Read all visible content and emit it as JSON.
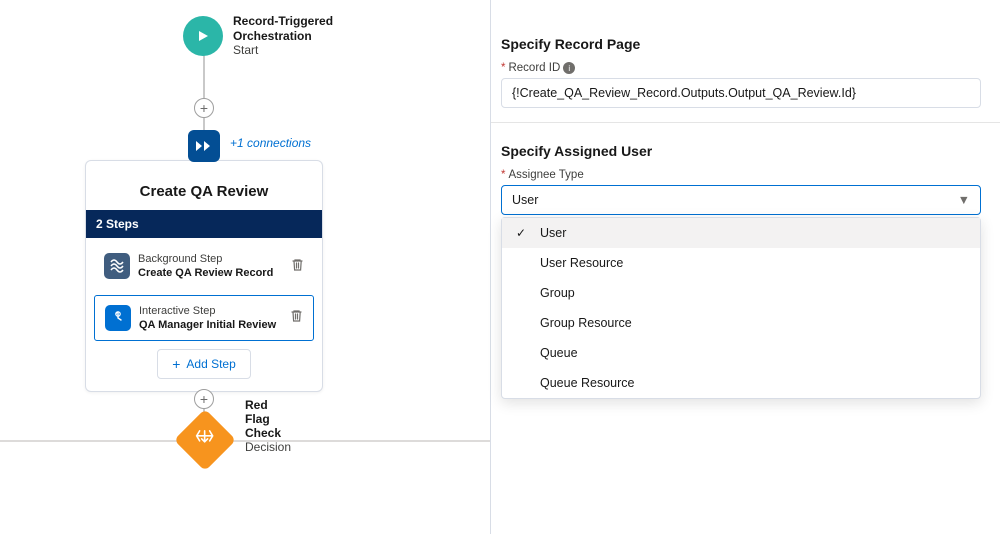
{
  "canvas": {
    "start": {
      "title": "Record-Triggered\nOrchestration",
      "subtitle": "Start"
    },
    "connections_label": "+1 connections",
    "stage": {
      "title": "Create QA Review",
      "steps_header": "2 Steps",
      "steps": [
        {
          "type_label": "Background Step",
          "name": "Create QA Review Record"
        },
        {
          "type_label": "Interactive Step",
          "name": "QA Manager Initial Review"
        }
      ],
      "add_step_label": "Add Step"
    },
    "decision": {
      "title": "Red Flag Check",
      "subtitle": "Decision"
    }
  },
  "panel": {
    "record_page_heading": "Specify Record Page",
    "record_id_label": "Record ID",
    "record_id_value": "{!Create_QA_Review_Record.Outputs.Output_QA_Review.Id}",
    "assigned_user_heading": "Specify Assigned User",
    "assignee_type_label": "Assignee Type",
    "assignee_type_value": "User",
    "assignee_options": [
      {
        "label": "User",
        "selected": true
      },
      {
        "label": "User Resource",
        "selected": false
      },
      {
        "label": "Group",
        "selected": false
      },
      {
        "label": "Group Resource",
        "selected": false
      },
      {
        "label": "Queue",
        "selected": false
      },
      {
        "label": "Queue Resource",
        "selected": false
      }
    ]
  }
}
